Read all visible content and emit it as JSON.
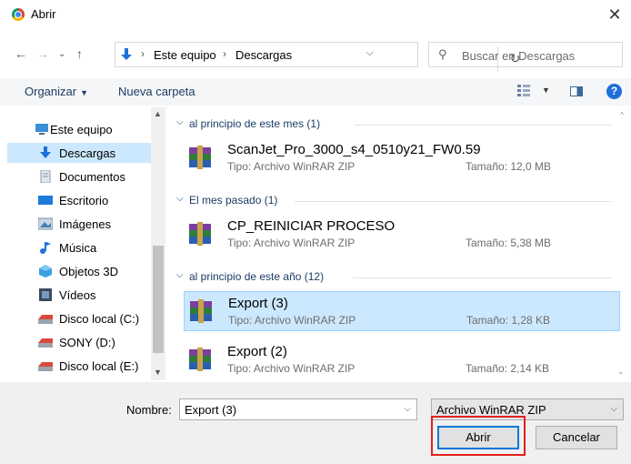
{
  "window": {
    "title": "Abrir"
  },
  "address": {
    "crumbs": [
      "Este equipo",
      "Descargas"
    ],
    "search_placeholder": "Buscar en Descargas"
  },
  "toolbar": {
    "organize": "Organizar",
    "new_folder": "Nueva carpeta"
  },
  "sidebar": {
    "items": [
      {
        "label": "Este equipo",
        "icon": "computer-icon"
      },
      {
        "label": "Descargas",
        "icon": "download-folder-icon",
        "selected": true
      },
      {
        "label": "Documentos",
        "icon": "documents-folder-icon"
      },
      {
        "label": "Escritorio",
        "icon": "desktop-folder-icon"
      },
      {
        "label": "Imágenes",
        "icon": "pictures-folder-icon"
      },
      {
        "label": "Música",
        "icon": "music-folder-icon"
      },
      {
        "label": "Objetos 3D",
        "icon": "3d-objects-folder-icon"
      },
      {
        "label": "Vídeos",
        "icon": "videos-folder-icon"
      },
      {
        "label": "Disco local (C:)",
        "icon": "drive-icon"
      },
      {
        "label": "SONY (D:)",
        "icon": "drive-icon"
      },
      {
        "label": "Disco local (E:)",
        "icon": "drive-icon"
      }
    ]
  },
  "files": {
    "groups": [
      {
        "label": "al principio de este mes (1)",
        "items": [
          {
            "name": "ScanJet_Pro_3000_s4_0510y21_FW0.59",
            "type": "Tipo: Archivo WinRAR ZIP",
            "size": "Tamaño: 12,0 MB"
          }
        ]
      },
      {
        "label": "El mes pasado (1)",
        "items": [
          {
            "name": "CP_REINICIAR PROCESO",
            "type": "Tipo: Archivo WinRAR ZIP",
            "size": "Tamaño: 5,38 MB"
          }
        ]
      },
      {
        "label": "al principio de este año (12)",
        "items": [
          {
            "name": "Export (3)",
            "type": "Tipo: Archivo WinRAR ZIP",
            "size": "Tamaño: 1,28 KB",
            "selected": true
          },
          {
            "name": "Export (2)",
            "type": "Tipo: Archivo WinRAR ZIP",
            "size": "Tamaño: 2,14 KB"
          }
        ]
      }
    ]
  },
  "bottom": {
    "name_label": "Nombre:",
    "name_value": "Export (3)",
    "type_value": "Archivo WinRAR ZIP",
    "open_label": "Abrir",
    "cancel_label": "Cancelar"
  },
  "colors": {
    "selection": "#cce8ff",
    "accent": "#0078d7",
    "highlight_box": "#e2211c"
  }
}
